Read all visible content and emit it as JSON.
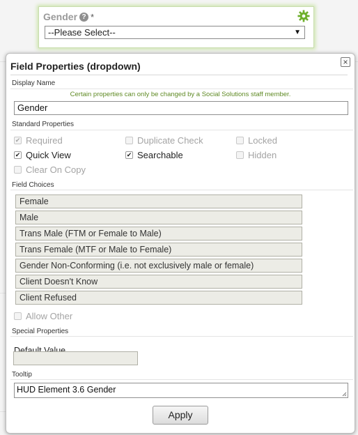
{
  "field": {
    "label": "Gender",
    "required_marker": "*",
    "help_icon": "question-circle-icon",
    "settings_icon": "gear-icon",
    "select_value": "--Please Select--"
  },
  "dialog": {
    "title": "Field Properties (dropdown)",
    "close_label": "×",
    "display_name": {
      "section_label": "Display Name",
      "notice": "Certain properties can only be changed by a Social Solutions staff member.",
      "value": "Gender"
    },
    "standard_properties": {
      "section_label": "Standard Properties",
      "items": [
        {
          "label": "Required",
          "checked": true,
          "disabled": true
        },
        {
          "label": "Duplicate Check",
          "checked": false,
          "disabled": true
        },
        {
          "label": "Locked",
          "checked": false,
          "disabled": true
        },
        {
          "label": "Quick View",
          "checked": true,
          "disabled": false
        },
        {
          "label": "Searchable",
          "checked": true,
          "disabled": false
        },
        {
          "label": "Hidden",
          "checked": false,
          "disabled": true
        },
        {
          "label": "Clear On Copy",
          "checked": false,
          "disabled": true
        }
      ]
    },
    "field_choices": {
      "section_label": "Field Choices",
      "items": [
        "Female",
        "Male",
        "Trans Male (FTM or Female to Male)",
        "Trans Female (MTF or Male to Female)",
        "Gender Non-Conforming (i.e. not exclusively male or female)",
        "Client Doesn't Know",
        "Client Refused"
      ],
      "allow_other": {
        "label": "Allow Other",
        "checked": false,
        "disabled": true
      }
    },
    "special_properties": {
      "section_label": "Special Properties",
      "default_value_label": "Default Value",
      "default_value": ""
    },
    "tooltip": {
      "section_label": "Tooltip",
      "value": "HUD Element 3.6 Gender"
    },
    "apply_label": "Apply"
  },
  "colors": {
    "accent_green": "#5f8a24",
    "gear_green": "#6fb02c",
    "highlight_glow": "#cfe6b0"
  }
}
